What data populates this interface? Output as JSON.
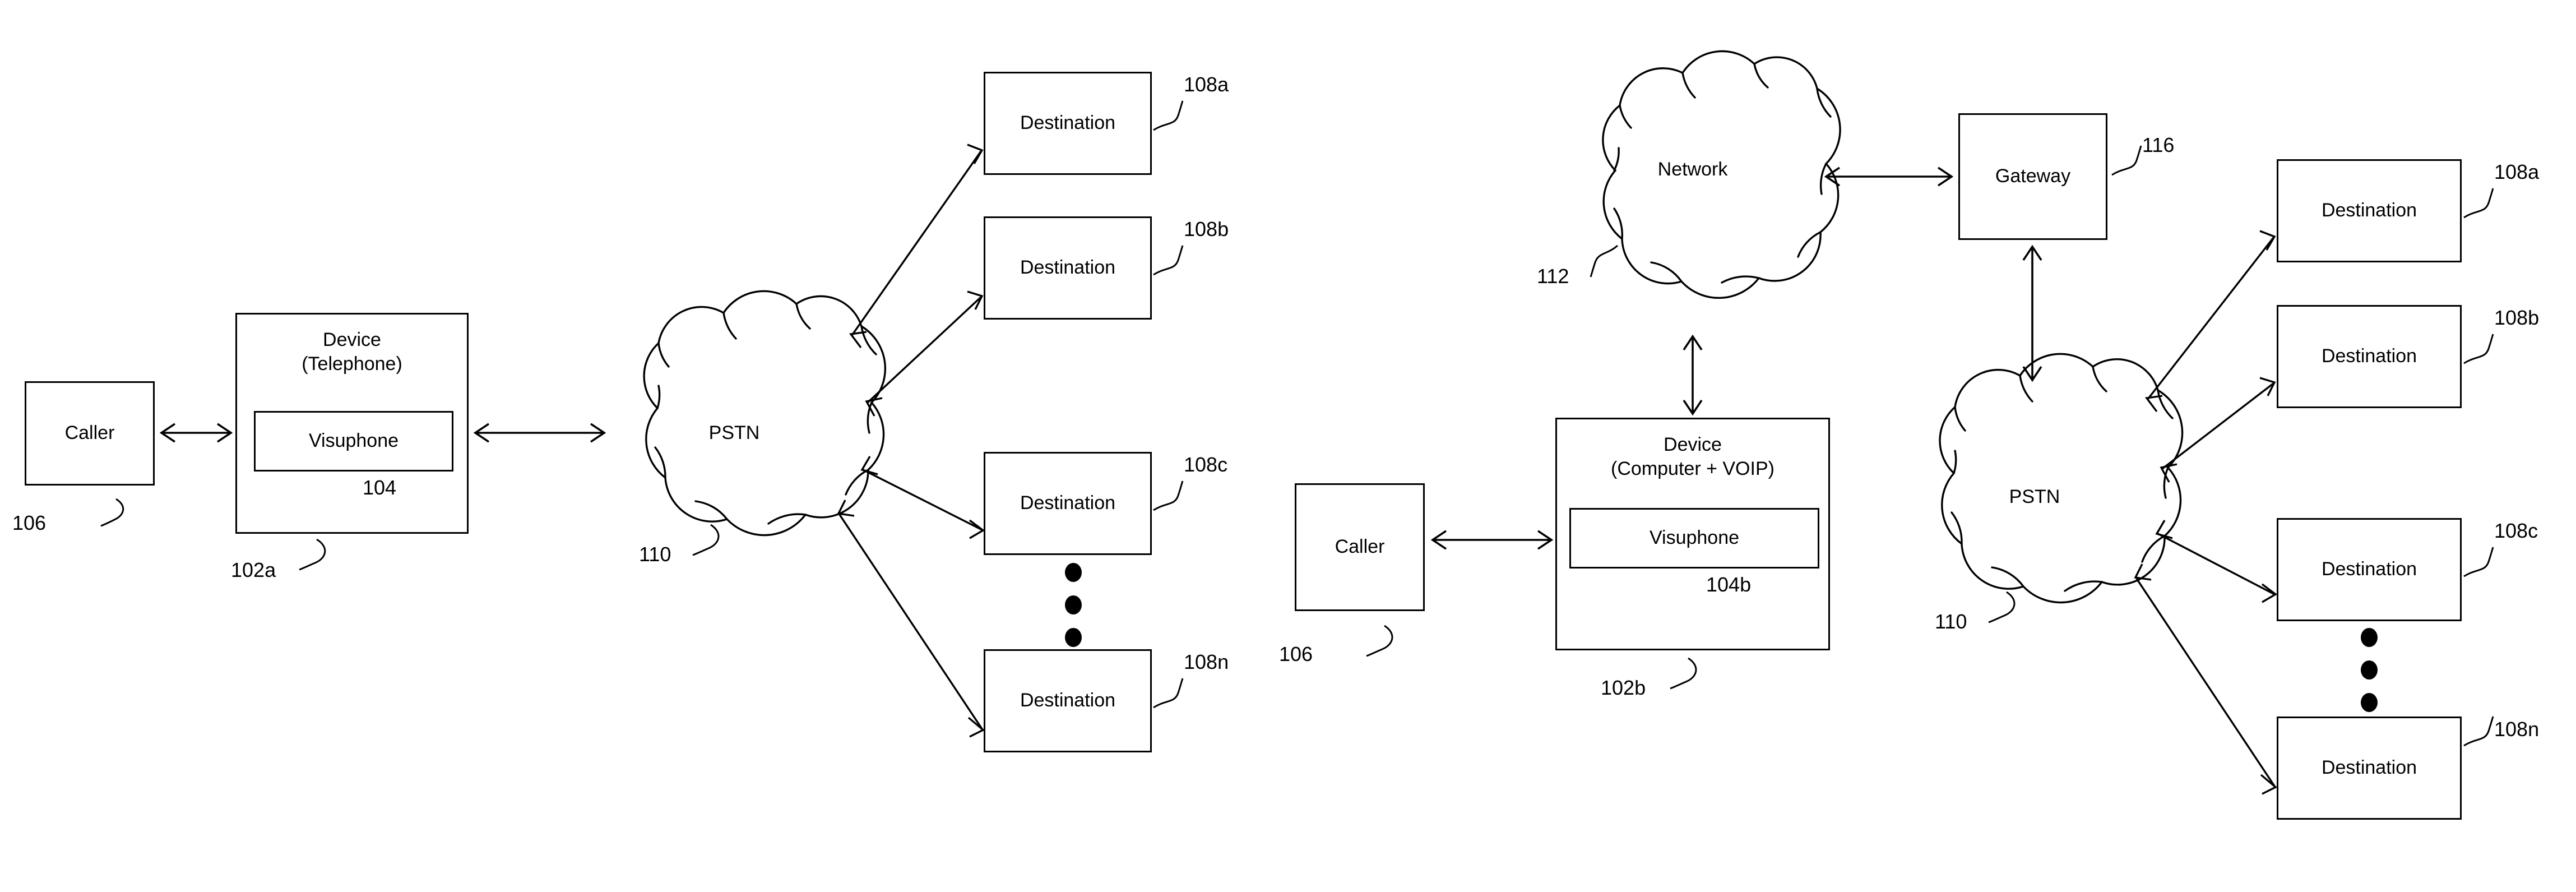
{
  "figure": {
    "kind": "patent-block-diagram",
    "stroke_color": "#000000",
    "background_color": "#ffffff"
  },
  "diagrams": [
    {
      "id": "left",
      "nodes": {
        "caller": {
          "label": "Caller",
          "ref": "106"
        },
        "device": {
          "title": "Device\n(Telephone)",
          "ref": "102a"
        },
        "visuphone": {
          "label": "Visuphone",
          "ref": "104"
        },
        "pstn": {
          "label": "PSTN",
          "ref": "110"
        }
      },
      "destinations": [
        {
          "label": "Destination",
          "ref": "108a"
        },
        {
          "label": "Destination",
          "ref": "108b"
        },
        {
          "label": "Destination",
          "ref": "108c"
        },
        {
          "label": "Destination",
          "ref": "108n"
        }
      ],
      "ellipsis_dots": 3
    },
    {
      "id": "right",
      "nodes": {
        "caller": {
          "label": "Caller",
          "ref": "106"
        },
        "device": {
          "title": "Device\n(Computer + VOIP)",
          "ref": "102b"
        },
        "visuphone": {
          "label": "Visuphone",
          "ref": "104b"
        },
        "network": {
          "label": "Network",
          "ref": "112"
        },
        "gateway": {
          "label": "Gateway",
          "ref": "116"
        },
        "pstn": {
          "label": "PSTN",
          "ref": "110"
        }
      },
      "destinations": [
        {
          "label": "Destination",
          "ref": "108a"
        },
        {
          "label": "Destination",
          "ref": "108b"
        },
        {
          "label": "Destination",
          "ref": "108c"
        },
        {
          "label": "Destination",
          "ref": "108n"
        }
      ],
      "ellipsis_dots": 3
    }
  ]
}
